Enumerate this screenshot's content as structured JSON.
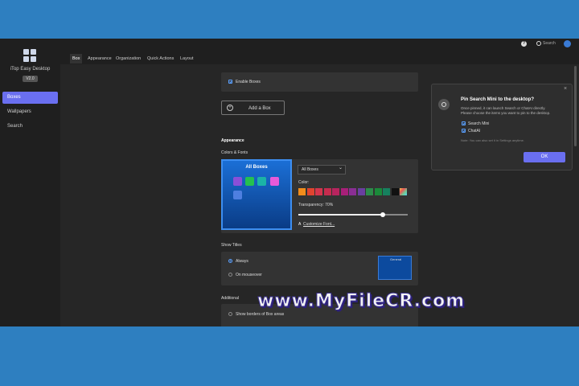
{
  "app": {
    "name": "iTop Easy Desktop",
    "version": "V2.0"
  },
  "sidebar": {
    "items": [
      {
        "label": "Boxes",
        "active": true
      },
      {
        "label": "Wallpapers",
        "active": false
      },
      {
        "label": "Search",
        "active": false
      }
    ]
  },
  "header": {
    "search_label": "Search"
  },
  "tabs": [
    {
      "label": "Box",
      "active": true
    },
    {
      "label": "Appearance",
      "active": false
    },
    {
      "label": "Organization",
      "active": false
    },
    {
      "label": "Quick Actions",
      "active": false
    },
    {
      "label": "Layout",
      "active": false
    }
  ],
  "box": {
    "enable_label": "Enable Boxes",
    "add_label": "Add a Box"
  },
  "appearance": {
    "section_title": "Appearance",
    "colors_fonts_label": "Colors & Fonts",
    "preview_title": "All Boxes",
    "dropdown_value": "All Boxes",
    "color_label": "Color:",
    "transparency_label": "Transparency: 70%",
    "transparency_value": 0.7,
    "customize_font": "Customize Font...",
    "swatches": [
      "#f28c1b",
      "#e0442f",
      "#d4354d",
      "#c62c4e",
      "#b8245e",
      "#a81f78",
      "#8a2e94",
      "#6a3fa0",
      "#2c8c4a",
      "#1b8a3a",
      "#16805e",
      "#111111",
      "#ffffff"
    ]
  },
  "show_titles": {
    "label": "Show Titles",
    "always": "Always",
    "mouseover": "On mouseover",
    "mini_title": "General"
  },
  "additional": {
    "label": "Additional",
    "borders": "Show borders of Box areas"
  },
  "popup": {
    "title": "Pin Search Mini to the desktop?",
    "line1": "Once pinned, it can launch Search or ChatAI directly.",
    "line2": "Please choose the items you want to pin to the desktop.",
    "opt1": "Search Mini",
    "opt2": "ChatAI",
    "note": "Note: You can also set it in Settings anytime.",
    "ok": "OK",
    "close": "×"
  },
  "watermark": "www.MyFileCR.com"
}
